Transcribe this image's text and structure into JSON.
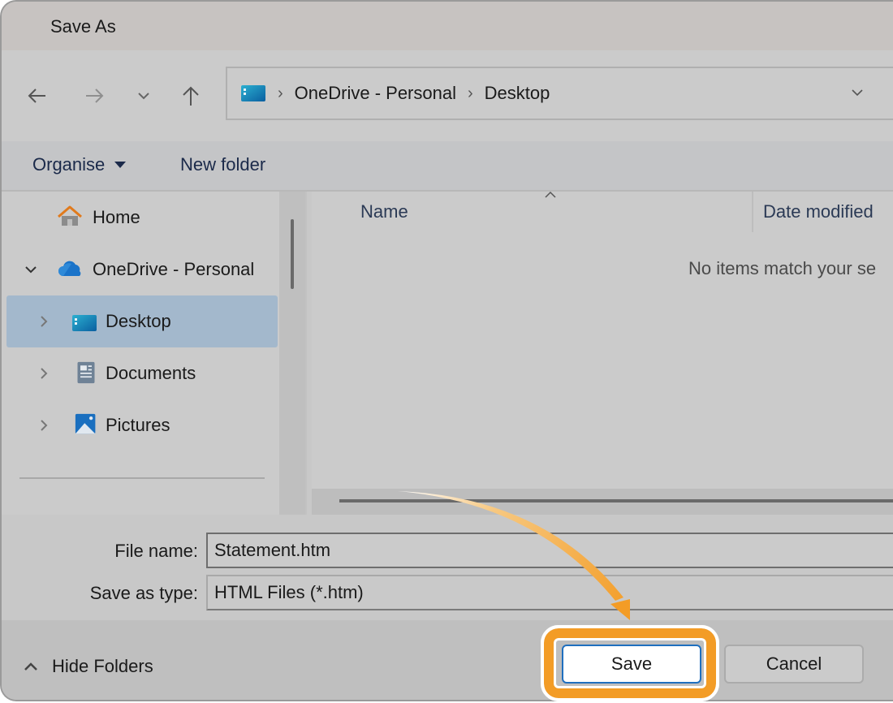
{
  "window": {
    "title": "Save As"
  },
  "nav": {
    "back_icon": "arrow-left-icon",
    "forward_icon": "arrow-right-icon",
    "recent_icon": "chevron-down-icon",
    "up_icon": "arrow-up-icon"
  },
  "address_bar": {
    "root_icon": "desktop-folder-icon",
    "breadcrumbs": [
      "OneDrive - Personal",
      "Desktop"
    ],
    "separator": "›"
  },
  "toolbar": {
    "organise_label": "Organise",
    "new_folder_label": "New folder"
  },
  "sidebar": {
    "items": [
      {
        "label": "Home",
        "icon": "home-icon",
        "expander": "none",
        "selected": false
      },
      {
        "label": "OneDrive - Personal",
        "icon": "onedrive-cloud-icon",
        "expander": "expanded",
        "selected": false
      },
      {
        "label": "Desktop",
        "icon": "desktop-folder-icon",
        "expander": "collapsed",
        "selected": true
      },
      {
        "label": "Documents",
        "icon": "documents-icon",
        "expander": "collapsed",
        "selected": false
      },
      {
        "label": "Pictures",
        "icon": "pictures-icon",
        "expander": "collapsed",
        "selected": false
      }
    ]
  },
  "file_list": {
    "columns": [
      "Name",
      "Date modified"
    ],
    "sort_column": "Name",
    "sort_direction": "ascending",
    "empty_message": "No items match your se"
  },
  "form": {
    "file_name_label": "File name:",
    "file_name_value": "Statement.htm",
    "save_type_label": "Save as type:",
    "save_type_value": "HTML Files (*.htm)"
  },
  "footer": {
    "hide_folders_label": "Hide Folders",
    "save_label": "Save",
    "cancel_label": "Cancel"
  },
  "annotation": {
    "highlight_color": "#f39c26",
    "target": "Save"
  },
  "colors": {
    "selection": "#a3b8cc",
    "primary_border": "#1f6fbf",
    "accent": "#f39c26"
  }
}
